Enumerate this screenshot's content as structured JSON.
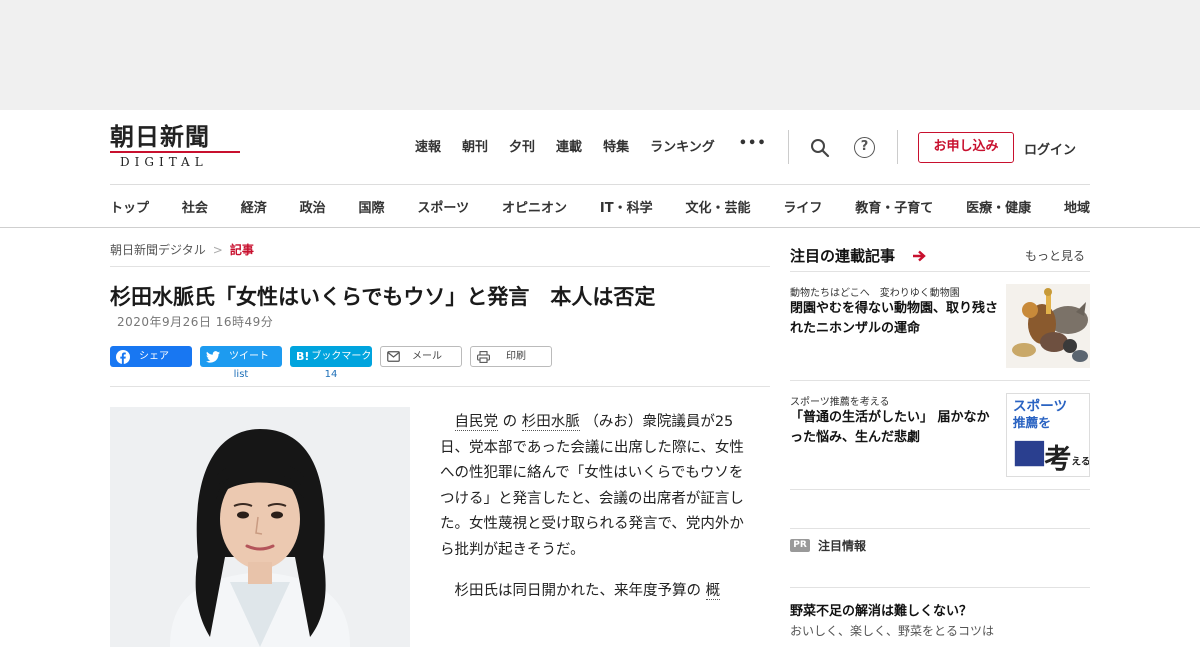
{
  "header": {
    "logo_main": "朝日新聞",
    "logo_sub": "DIGITAL",
    "topnav": [
      "速報",
      "朝刊",
      "夕刊",
      "連載",
      "特集",
      "ランキング"
    ],
    "more": "•••",
    "help": "?",
    "apply_label": "お申し込み",
    "login_label": "ログイン"
  },
  "categories": [
    "トップ",
    "社会",
    "経済",
    "政治",
    "国際",
    "スポーツ",
    "オピニオン",
    "IT・科学",
    "文化・芸能",
    "ライフ",
    "教育・子育て",
    "医療・健康",
    "地域"
  ],
  "breadcrumb": {
    "home": "朝日新聞デジタル",
    "sep": ">",
    "current": "記事"
  },
  "article": {
    "headline": "杉田水脈氏「女性はいくらでもウソ」と発言　本人は否定",
    "date": "2020年9月26日 16時49分",
    "share": {
      "facebook": "シェア",
      "twitter": "ツイート",
      "twitter_count": "list",
      "hatena_icon": "B!",
      "hatena": "ブックマーク",
      "hatena_count": "14",
      "mail": "メール",
      "print": "印刷"
    },
    "p1_link1": "自民党",
    "p1_mid1": " の ",
    "p1_link2": "杉田水脈",
    "p1_rest": " （みお）衆院議員が25日、党本部であった会議に出席した際に、女性への性犯罪に絡んで「女性はいくらでもウソをつける」と発言したと、会議の出席者が証言した。女性蔑視と受け取られる発言で、党内外から批判が起きそうだ。",
    "p2_start": "杉田氏は同日開かれた、来年度予算の ",
    "p2_link": "概"
  },
  "sidebar": {
    "title": "注目の連載記事",
    "more": "もっと見る",
    "cards": [
      {
        "kicker": "動物たちはどこへ　変わりゆく動物園",
        "title": "閉園やむを得ない動物園、取り残されたニホンザルの運命"
      },
      {
        "kicker": "スポーツ推薦を考える",
        "title": "「普通の生活がしたい」 届かなかった悩み、生んだ悲劇",
        "thumb_line1": "スポーツ",
        "thumb_line2": "推薦を",
        "thumb_big": "考",
        "thumb_small": "える"
      }
    ],
    "pr_badge": "PR",
    "pr_label": "注目情報",
    "pr_title": "野菜不足の解消は難しくない？",
    "pr_sub": "おいしく、楽しく、野菜をとるコツは"
  },
  "colors": {
    "accent": "#c8102e",
    "facebook": "#1877f2",
    "twitter": "#1d9bf0",
    "hatena": "#00a4de"
  }
}
